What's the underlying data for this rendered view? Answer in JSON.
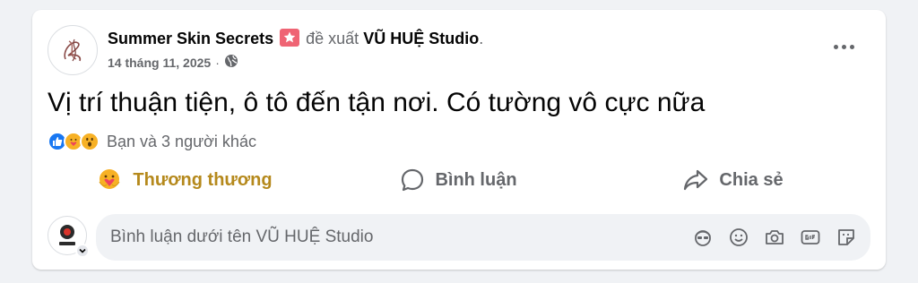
{
  "post": {
    "author": "Summer Skin Secrets",
    "action_text": "đề xuất",
    "target": "VŨ HUỆ Studio",
    "period": ".",
    "date": "14 tháng 11, 2025",
    "separator": "·",
    "text": "Vị trí thuận tiện, ô tô đến tận nơi. Có tường vô cực nữa"
  },
  "reactions": {
    "summary": "Bạn và 3 người khác",
    "icons": [
      "like-icon",
      "care-icon",
      "wow-icon"
    ]
  },
  "actions": {
    "react_label": "Thương thương",
    "comment_label": "Bình luận",
    "share_label": "Chia sẻ"
  },
  "comment": {
    "placeholder": "Bình luận dưới tên VŨ HUỆ Studio",
    "tools": [
      "avatar-sticker-icon",
      "emoji-icon",
      "camera-icon",
      "gif-icon",
      "sticker-icon"
    ]
  },
  "colors": {
    "reacted": "#b5891c",
    "recommend_badge": "#ef6474",
    "like_blue": "#1877f2",
    "muted": "#65676b"
  }
}
